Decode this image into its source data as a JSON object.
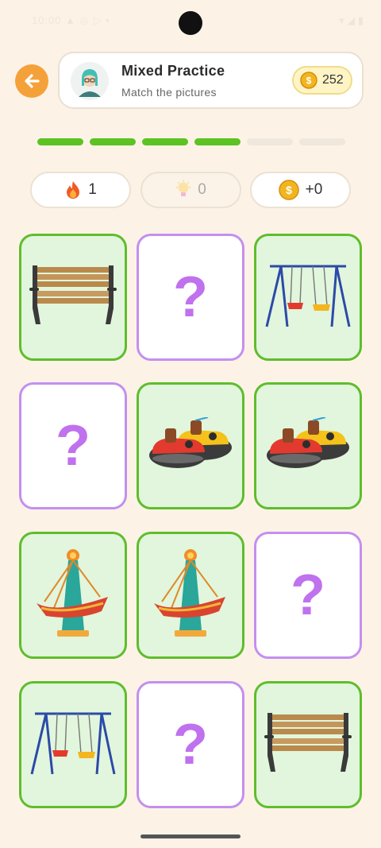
{
  "status": {
    "left": "10:00 ▲ ◎ ▷ •",
    "right": "▾ ◢ ▮"
  },
  "header": {
    "title": "Mixed Practice",
    "subtitle": "Match the pictures",
    "coins": "252"
  },
  "progress": {
    "segments": [
      "filled",
      "filled",
      "filled",
      "filled",
      "empty",
      "empty"
    ],
    "filled_color": "#5cc323",
    "empty_color": "#f0e8dc"
  },
  "stats": {
    "streak": "1",
    "hints": "0",
    "bonus": "+0"
  },
  "board": {
    "cards": [
      {
        "state": "matched",
        "picture": "bench"
      },
      {
        "state": "hidden",
        "label": "?"
      },
      {
        "state": "matched",
        "picture": "swing"
      },
      {
        "state": "hidden",
        "label": "?"
      },
      {
        "state": "matched",
        "picture": "bumper-cars"
      },
      {
        "state": "matched",
        "picture": "bumper-cars"
      },
      {
        "state": "matched",
        "picture": "pirate-ship-ride"
      },
      {
        "state": "matched",
        "picture": "pirate-ship-ride"
      },
      {
        "state": "hidden",
        "label": "?"
      },
      {
        "state": "matched",
        "picture": "swing"
      },
      {
        "state": "hidden",
        "label": "?"
      },
      {
        "state": "matched",
        "picture": "bench"
      }
    ]
  },
  "colors": {
    "accent_orange": "#f5a13a",
    "matched_border": "#5fbd2d",
    "hidden_border": "#c48ff0",
    "question_mark": "#c071ee"
  }
}
